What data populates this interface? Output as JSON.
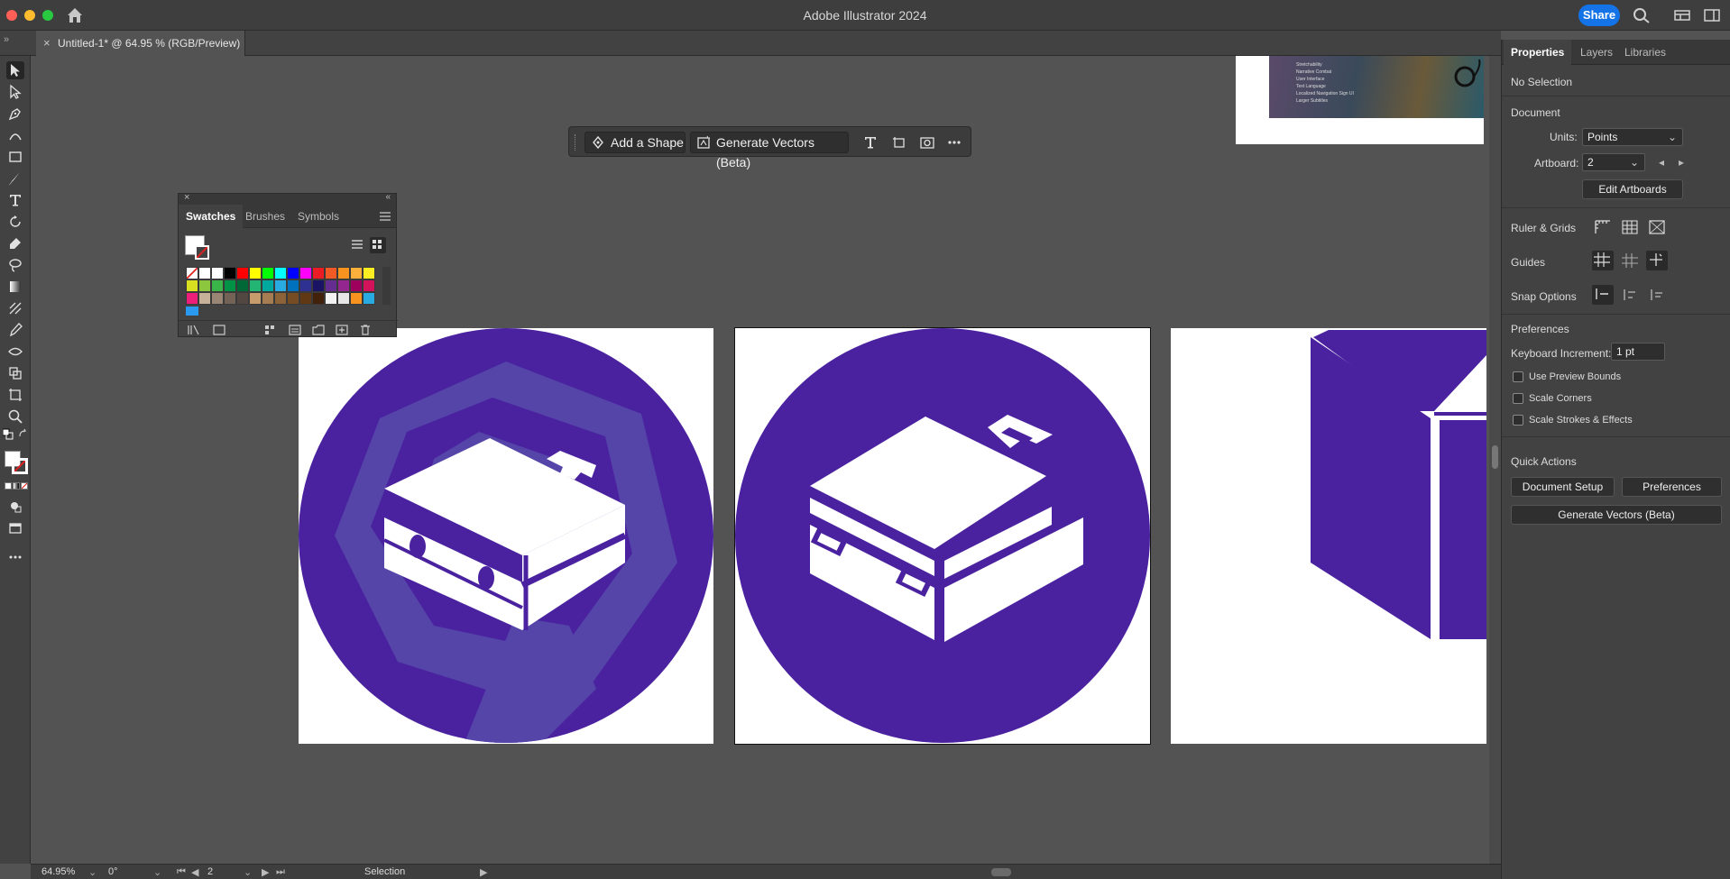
{
  "app": {
    "title": "Adobe Illustrator 2024",
    "share_label": "Share"
  },
  "document": {
    "tab_label": "Untitled-1* @ 64.95 % (RGB/Preview)"
  },
  "taskbar": {
    "add_shape_label": "Add a Shape",
    "generate_vectors_label": "Generate Vectors (Beta)"
  },
  "swatches": {
    "tabs": [
      "Swatches",
      "Brushes",
      "Symbols"
    ],
    "colors": [
      "#ffffff",
      "#ffffff",
      "#ffffff",
      "#000000",
      "#ff0000",
      "#ffff00",
      "#00ff00",
      "#00ffff",
      "#0000ff",
      "#ff00ff",
      "#ed1c24",
      "#f15a24",
      "#f7931e",
      "#fbb03b",
      "#fcee21",
      "#d9e021",
      "#8cc63f",
      "#39b54a",
      "#009245",
      "#006837",
      "#22b573",
      "#00a99d",
      "#29abe2",
      "#0071bc",
      "#2e3192",
      "#1b1464",
      "#662d91",
      "#93278f",
      "#9e005d",
      "#d4145a",
      "#ed1e79",
      "#c7b299",
      "#998675",
      "#736357",
      "#534741",
      "#c69c6d",
      "#a67c52",
      "#8c6239",
      "#754c24",
      "#603813",
      "#42210b",
      "#f2f2f2",
      "#e6e6e6",
      "#f7931e",
      "#29abe2"
    ]
  },
  "status": {
    "zoom": "64.95%",
    "rotation": "0°",
    "artboard_num": "2",
    "tool": "Selection"
  },
  "properties": {
    "tabs": [
      "Properties",
      "Layers",
      "Libraries"
    ],
    "selection": "No Selection",
    "document_heading": "Document",
    "units_label": "Units:",
    "units_value": "Points",
    "artboard_label": "Artboard:",
    "artboard_value": "2",
    "edit_artboards": "Edit Artboards",
    "ruler_grids": "Ruler & Grids",
    "guides": "Guides",
    "snap_options": "Snap Options",
    "preferences_heading": "Preferences",
    "keyboard_increment_label": "Keyboard Increment:",
    "keyboard_increment_value": "1 pt",
    "checkboxes": [
      "Use Preview Bounds",
      "Scale Corners",
      "Scale Strokes & Effects"
    ],
    "quick_actions": "Quick Actions",
    "document_setup": "Document Setup",
    "preferences_btn": "Preferences",
    "generate_vectors": "Generate Vectors (Beta)"
  },
  "colors": {
    "accent": "#1473e6",
    "purple": "#4a22a0",
    "purple_light": "#5545a8"
  },
  "minimap_text": [
    "Stretchability",
    "Narrative Combat",
    "User Interface",
    "Text Language",
    "Localized Navigation Sign UI",
    "Larger Subtitles"
  ]
}
